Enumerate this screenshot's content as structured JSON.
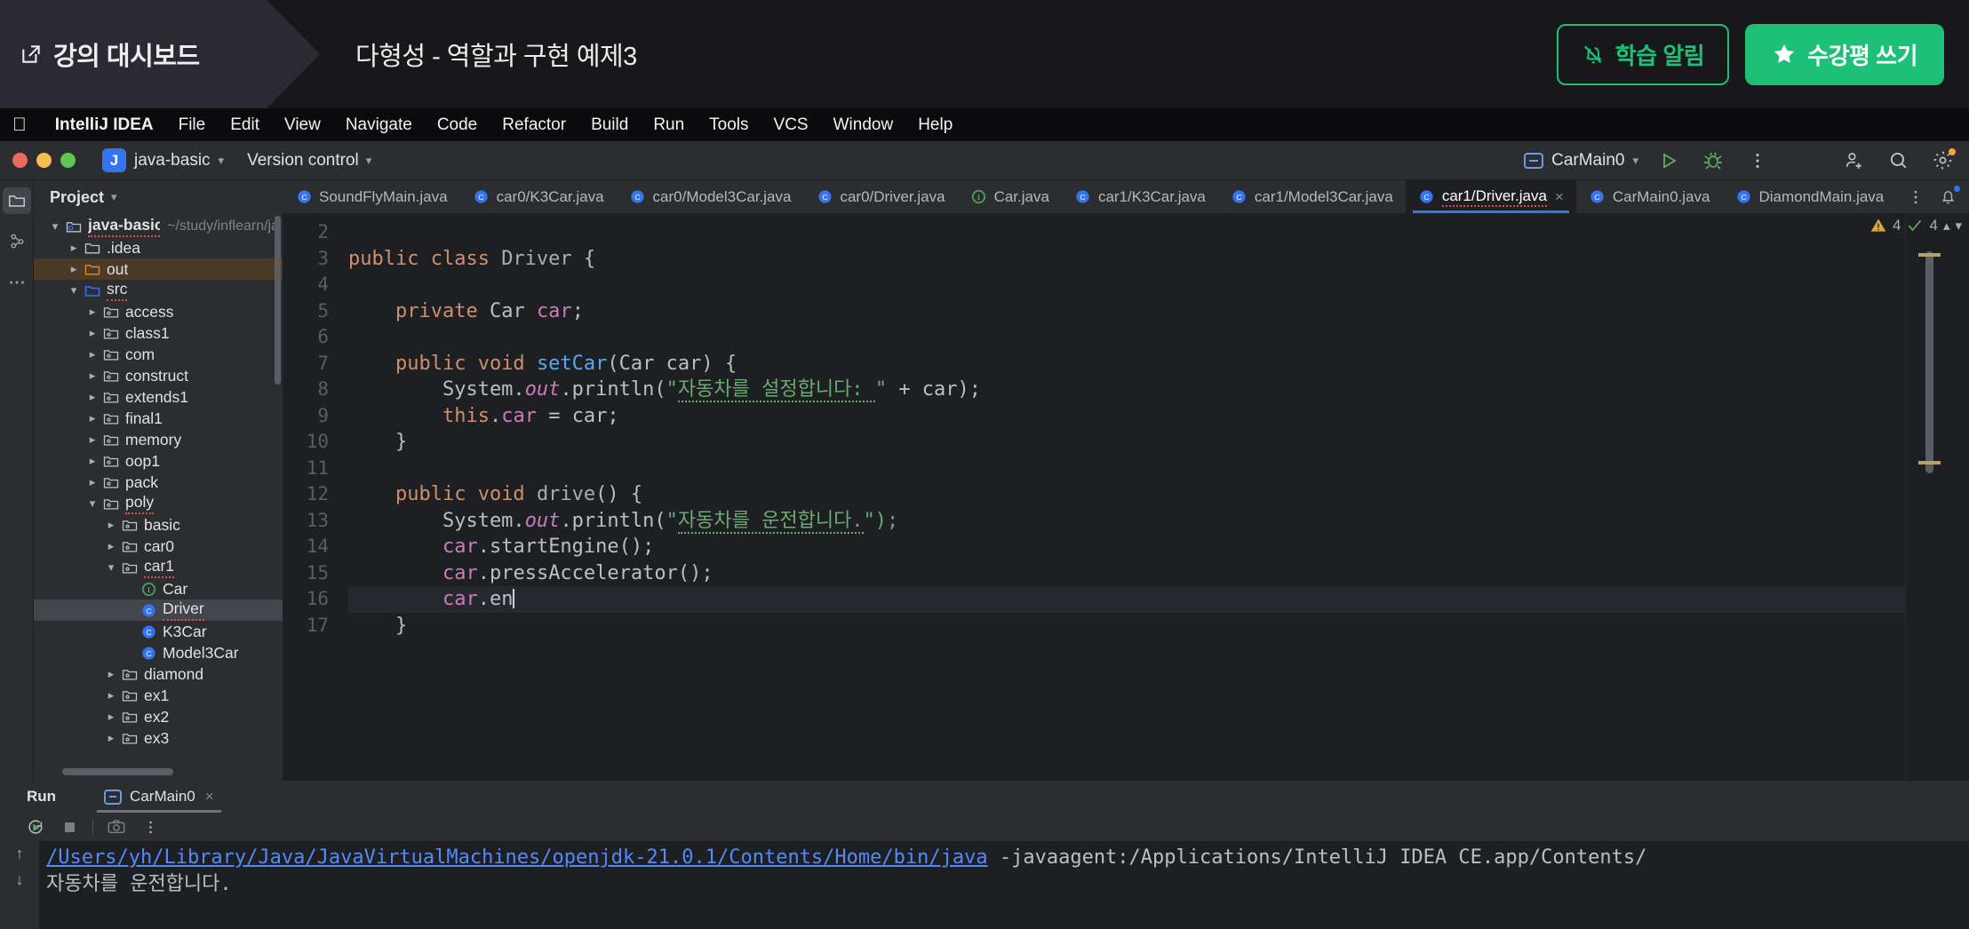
{
  "inflearn": {
    "breadcrumb_icon": "external-link-icon",
    "breadcrumb_label": "강의 대시보드",
    "lecture_title": "다형성 - 역할과 구현 예제3",
    "notify_icon": "bell-off-icon",
    "notify_label": "학습 알림",
    "review_icon": "star-icon",
    "review_label": "수강평 쓰기",
    "accent_green": "#1dc078",
    "header_bg": "#18181b",
    "breadcrumb_bg": "#2b2a33"
  },
  "mac_menu": {
    "apple_icon": "apple-logo-icon",
    "items": [
      "IntelliJ IDEA",
      "File",
      "Edit",
      "View",
      "Navigate",
      "Code",
      "Refactor",
      "Build",
      "Run",
      "Tools",
      "VCS",
      "Window",
      "Help"
    ]
  },
  "ide_toolbar": {
    "project_badge": "J",
    "project_name": "java-basic",
    "version_control": "Version control",
    "run_config": "CarMain0",
    "icons": [
      "run-icon",
      "debug-icon",
      "more-options-icon",
      "add-user-icon",
      "search-icon",
      "settings-icon"
    ]
  },
  "sidebar": {
    "rail_icons": [
      "project-folder-icon",
      "structure-icon",
      "more-tool-windows-icon"
    ],
    "title": "Project",
    "tree": [
      {
        "label": "java-basic",
        "path": "~/study/inflearn/ja",
        "indent": 0,
        "twisty": "down",
        "icon": "module-icon",
        "bold": true,
        "err": true
      },
      {
        "label": ".idea",
        "path": "",
        "indent": 1,
        "twisty": "right",
        "icon": "folder-icon"
      },
      {
        "label": "out",
        "path": "",
        "indent": 1,
        "twisty": "right",
        "icon": "folder-orange-icon",
        "state": "sel-out"
      },
      {
        "label": "src",
        "path": "",
        "indent": 1,
        "twisty": "down",
        "icon": "folder-blue-icon",
        "err": true
      },
      {
        "label": "access",
        "path": "",
        "indent": 2,
        "twisty": "right",
        "icon": "package-icon"
      },
      {
        "label": "class1",
        "path": "",
        "indent": 2,
        "twisty": "right",
        "icon": "package-icon"
      },
      {
        "label": "com",
        "path": "",
        "indent": 2,
        "twisty": "right",
        "icon": "package-icon"
      },
      {
        "label": "construct",
        "path": "",
        "indent": 2,
        "twisty": "right",
        "icon": "package-icon"
      },
      {
        "label": "extends1",
        "path": "",
        "indent": 2,
        "twisty": "right",
        "icon": "package-icon"
      },
      {
        "label": "final1",
        "path": "",
        "indent": 2,
        "twisty": "right",
        "icon": "package-icon"
      },
      {
        "label": "memory",
        "path": "",
        "indent": 2,
        "twisty": "right",
        "icon": "package-icon"
      },
      {
        "label": "oop1",
        "path": "",
        "indent": 2,
        "twisty": "right",
        "icon": "package-icon"
      },
      {
        "label": "pack",
        "path": "",
        "indent": 2,
        "twisty": "right",
        "icon": "package-icon"
      },
      {
        "label": "poly",
        "path": "",
        "indent": 2,
        "twisty": "down",
        "icon": "package-icon",
        "err": true
      },
      {
        "label": "basic",
        "path": "",
        "indent": 3,
        "twisty": "right",
        "icon": "package-icon"
      },
      {
        "label": "car0",
        "path": "",
        "indent": 3,
        "twisty": "right",
        "icon": "package-icon"
      },
      {
        "label": "car1",
        "path": "",
        "indent": 3,
        "twisty": "down",
        "icon": "package-icon",
        "err": true
      },
      {
        "label": "Car",
        "path": "",
        "indent": 4,
        "twisty": "none",
        "icon": "interface-icon"
      },
      {
        "label": "Driver",
        "path": "",
        "indent": 4,
        "twisty": "none",
        "icon": "class-icon",
        "state": "sel-gray",
        "err": true
      },
      {
        "label": "K3Car",
        "path": "",
        "indent": 4,
        "twisty": "none",
        "icon": "class-icon"
      },
      {
        "label": "Model3Car",
        "path": "",
        "indent": 4,
        "twisty": "none",
        "icon": "class-icon"
      },
      {
        "label": "diamond",
        "path": "",
        "indent": 3,
        "twisty": "right",
        "icon": "package-icon"
      },
      {
        "label": "ex1",
        "path": "",
        "indent": 3,
        "twisty": "right",
        "icon": "package-icon"
      },
      {
        "label": "ex2",
        "path": "",
        "indent": 3,
        "twisty": "right",
        "icon": "package-icon"
      },
      {
        "label": "ex3",
        "path": "",
        "indent": 3,
        "twisty": "right",
        "icon": "package-icon"
      }
    ]
  },
  "editor": {
    "tabs": [
      {
        "label": "SoundFlyMain.java",
        "icon": "class-icon",
        "active": false
      },
      {
        "label": "car0/K3Car.java",
        "icon": "class-icon",
        "active": false
      },
      {
        "label": "car0/Model3Car.java",
        "icon": "class-icon",
        "active": false
      },
      {
        "label": "car0/Driver.java",
        "icon": "class-icon",
        "active": false
      },
      {
        "label": "Car.java",
        "icon": "interface-icon",
        "active": false
      },
      {
        "label": "car1/K3Car.java",
        "icon": "class-icon",
        "active": false
      },
      {
        "label": "car1/Model3Car.java",
        "icon": "class-icon",
        "active": false
      },
      {
        "label": "car1/Driver.java",
        "icon": "class-icon",
        "active": true,
        "close": "×"
      },
      {
        "label": "CarMain0.java",
        "icon": "class-icon",
        "active": false
      },
      {
        "label": "DiamondMain.java",
        "icon": "class-icon",
        "active": false
      }
    ],
    "tabs_right_icons": [
      "more-tabs-icon",
      "notifications-bell-icon"
    ],
    "inspection": {
      "warning_icon": "warning-triangle-icon",
      "warning_count": "4",
      "ok_icon": "inspection-check-icon",
      "ok_count": "4",
      "up_icon": "chevron-up-icon",
      "down_icon": "chevron-down-icon"
    },
    "line_numbers": [
      "2",
      "3",
      "4",
      "5",
      "6",
      "7",
      "8",
      "9",
      "10",
      "11",
      "12",
      "13",
      "14",
      "15",
      "16",
      "17"
    ],
    "code": [
      {
        "n": "2",
        "segments": []
      },
      {
        "n": "3",
        "segments": [
          {
            "t": "public class ",
            "c": "k"
          },
          {
            "t": "Driver",
            "c": "cn"
          },
          {
            "t": " {",
            "c": "t"
          }
        ]
      },
      {
        "n": "4",
        "segments": []
      },
      {
        "n": "5",
        "segments": [
          {
            "t": "    ",
            "c": "t"
          },
          {
            "t": "private ",
            "c": "k"
          },
          {
            "t": "Car ",
            "c": "t"
          },
          {
            "t": "car",
            "c": "f"
          },
          {
            "t": ";",
            "c": "t"
          }
        ]
      },
      {
        "n": "6",
        "segments": []
      },
      {
        "n": "7",
        "segments": [
          {
            "t": "    ",
            "c": "t"
          },
          {
            "t": "public void ",
            "c": "k"
          },
          {
            "t": "setCar",
            "c": "m"
          },
          {
            "t": "(Car car) {",
            "c": "t"
          }
        ]
      },
      {
        "n": "8",
        "segments": [
          {
            "t": "        System.",
            "c": "t"
          },
          {
            "t": "out",
            "c": "sf"
          },
          {
            "t": ".println(",
            "c": "t"
          },
          {
            "t": "\"",
            "c": "s"
          },
          {
            "t": "자동차를 설정합니다: ",
            "c": "kstr"
          },
          {
            "t": "\" ",
            "c": "s"
          },
          {
            "t": "+ car);",
            "c": "t"
          }
        ]
      },
      {
        "n": "9",
        "segments": [
          {
            "t": "        ",
            "c": "t"
          },
          {
            "t": "this",
            "c": "k"
          },
          {
            "t": ".",
            "c": "t"
          },
          {
            "t": "car",
            "c": "f"
          },
          {
            "t": " = car;",
            "c": "t"
          }
        ]
      },
      {
        "n": "10",
        "segments": [
          {
            "t": "    }",
            "c": "t"
          }
        ]
      },
      {
        "n": "11",
        "segments": []
      },
      {
        "n": "12",
        "segments": [
          {
            "t": "    ",
            "c": "t"
          },
          {
            "t": "public void ",
            "c": "k"
          },
          {
            "t": "drive",
            "c": "cn"
          },
          {
            "t": "() {",
            "c": "t"
          }
        ]
      },
      {
        "n": "13",
        "segments": [
          {
            "t": "        System.",
            "c": "t"
          },
          {
            "t": "out",
            "c": "sf"
          },
          {
            "t": ".println(",
            "c": "t"
          },
          {
            "t": "\"",
            "c": "s"
          },
          {
            "t": "자동차를 운전합니다.",
            "c": "kstr"
          },
          {
            "t": "\");",
            "c": "s"
          }
        ]
      },
      {
        "n": "14",
        "segments": [
          {
            "t": "        ",
            "c": "t"
          },
          {
            "t": "car",
            "c": "f"
          },
          {
            "t": ".startEngine();",
            "c": "t"
          }
        ]
      },
      {
        "n": "15",
        "segments": [
          {
            "t": "        ",
            "c": "t"
          },
          {
            "t": "car",
            "c": "f"
          },
          {
            "t": ".pressAccelerator();",
            "c": "t"
          }
        ]
      },
      {
        "n": "16",
        "segments": [
          {
            "t": "        ",
            "c": "t"
          },
          {
            "t": "car",
            "c": "f"
          },
          {
            "t": ".en",
            "c": "t"
          }
        ],
        "current": true,
        "caret": true
      },
      {
        "n": "17",
        "segments": [
          {
            "t": "    }",
            "c": "t"
          }
        ]
      }
    ]
  },
  "run_panel": {
    "label": "Run",
    "tab_label": "CarMain0",
    "tab_icon": "run-config-icon",
    "tab_close": "×",
    "toolbar_icons": [
      "rerun-icon",
      "stop-icon",
      "camera-icon",
      "more-icon"
    ],
    "rail_icons": [
      "scroll-up-icon",
      "scroll-down-icon"
    ],
    "console": [
      {
        "link": "/Users/yh/Library/Java/JavaVirtualMachines/openjdk-21.0.1/Contents/Home/bin/java",
        "rest": " -javaagent:/Applications/IntelliJ IDEA CE.app/Contents/"
      },
      {
        "link": "",
        "rest": "자동차를 운전합니다."
      }
    ]
  }
}
